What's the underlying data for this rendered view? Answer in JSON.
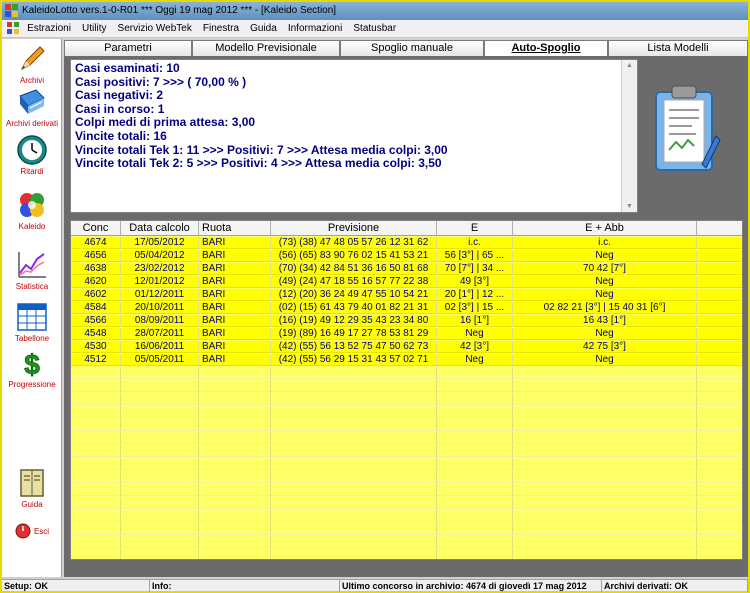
{
  "window": {
    "title": "KaleidoLotto vers.1-0-R01  ***  Oggi 19 mag 2012  ***   - [Kaleido Section]"
  },
  "menu": [
    "Estrazioni",
    "Utility",
    "Servizio WebTek",
    "Finestra",
    "Guida",
    "Informazioni",
    "Statusbar"
  ],
  "sidebar": {
    "archivi": "Archivi",
    "archivi_derivati": "Archivi derivati",
    "ritardi": "Ritardi",
    "kaleido": "Kaleido",
    "statistica": "Statistica",
    "tabellone": "Tabellone",
    "progressione": "Progressione",
    "guida": "Guida",
    "esci": "Esci"
  },
  "tabs": [
    "Parametri",
    "Modello Previsionale",
    "Spoglio manuale",
    "Auto-Spoglio",
    "Lista Modelli"
  ],
  "active_tab": "Auto-Spoglio",
  "summary": [
    "Casi esaminati: 10",
    "Casi positivi: 7 >>> ( 70,00 % )",
    "Casi negativi: 2",
    "Casi in corso: 1",
    "Colpi medi di prima attesa: 3,00",
    "Vincite totali: 16",
    "Vincite totali Tek 1: 11 >>> Positivi: 7 >>> Attesa media colpi: 3,00",
    "Vincite totali Tek 2: 5 >>> Positivi: 4 >>> Attesa media colpi: 3,50"
  ],
  "table": {
    "headers": [
      "Conc",
      "Data calcolo",
      "Ruota",
      "Previsione",
      "E",
      "E + Abb",
      ""
    ],
    "rows": [
      [
        "4674",
        "17/05/2012",
        "BARI",
        "(73) (38) 47 48 05 57 26 12 31 62",
        "i.c.",
        "i.c."
      ],
      [
        "4656",
        "05/04/2012",
        "BARI",
        "(56) (65) 83 90 76 02 15 41 53 21",
        "56 [3°] | 65 ...",
        "Neg"
      ],
      [
        "4638",
        "23/02/2012",
        "BARI",
        "(70) (34) 42 84 51 36 16 50 81 68",
        "70 [7°] | 34 ...",
        "70 42 [7°]"
      ],
      [
        "4620",
        "12/01/2012",
        "BARI",
        "(49) (24) 47 18 55 16 57 77 22 38",
        "49 [3°]",
        "Neg"
      ],
      [
        "4602",
        "01/12/2011",
        "BARI",
        "(12) (20) 36 24 49 47 55 10 54 21",
        "20 [1°] | 12 ...",
        "Neg"
      ],
      [
        "4584",
        "20/10/2011",
        "BARI",
        "(02) (15) 61 43 79 40 01 82 21 31",
        "02 [3°] | 15 ...",
        "02 82 21 [3°] | 15 40 31 [6°]"
      ],
      [
        "4566",
        "08/09/2011",
        "BARI",
        "(16) (19) 49 12 29 35 43 23 34 80",
        "16 [1°]",
        "16 43 [1°]"
      ],
      [
        "4548",
        "28/07/2011",
        "BARI",
        "(19) (89) 16 49 17 27 78 53 81 29",
        "Neg",
        "Neg"
      ],
      [
        "4530",
        "16/06/2011",
        "BARI",
        "(42) (55) 56 13 52 75 47 50 62 73",
        "42 [3°]",
        "42 75 [3°]"
      ],
      [
        "4512",
        "05/05/2011",
        "BARI",
        "(42) (55) 56 29 15 31 43 57 02 71",
        "Neg",
        "Neg"
      ]
    ]
  },
  "status": {
    "setup": "Setup: OK",
    "info": "Info:",
    "ultimo": "Ultimo concorso in archivio: 4674 di giovedì 17 mag 2012",
    "derivati": "Archivi derivati: OK"
  },
  "colors": {
    "grid_yellow": "#ffff00",
    "summary_text": "#000080",
    "sidebar_label": "#c00000",
    "window_border": "#e8d800"
  }
}
